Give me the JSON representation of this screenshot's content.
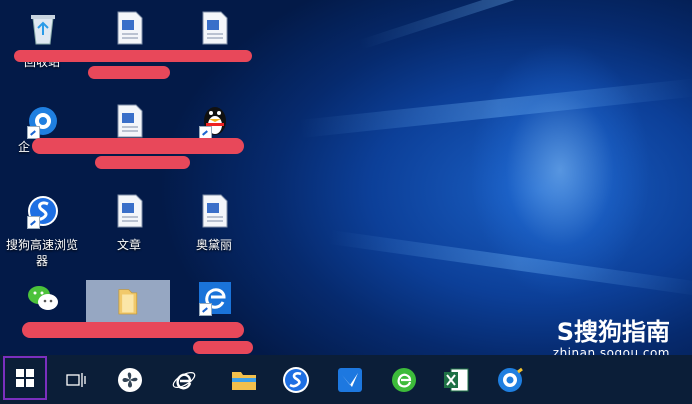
{
  "desktop": {
    "icons": [
      {
        "id": "recycle",
        "label": "回收站"
      },
      {
        "id": "doc1",
        "label": ""
      },
      {
        "id": "doc2",
        "label": ""
      },
      {
        "id": "qiyi",
        "label": "企"
      },
      {
        "id": "doc3",
        "label": ""
      },
      {
        "id": "qq",
        "label": ""
      },
      {
        "id": "sogou-browser",
        "label": "搜狗高速浏览\n器"
      },
      {
        "id": "wenzhang",
        "label": "文章"
      },
      {
        "id": "aodaili",
        "label": "奥黛丽"
      },
      {
        "id": "wechat",
        "label": ""
      },
      {
        "id": "folder",
        "label": ""
      },
      {
        "id": "edge",
        "label": ""
      }
    ]
  },
  "taskbar": {
    "items": [
      "start",
      "task-view",
      "fan-app",
      "ie",
      "file-explorer",
      "sogou",
      "feishu",
      "ie-green",
      "excel",
      "360"
    ]
  },
  "watermark": {
    "brand": "S搜狗指南",
    "url": "zhinan.sogou.com"
  },
  "colors": {
    "redact": "#e8485a",
    "taskbar": "#0b1e38",
    "start_highlight": "#7b2fbf"
  }
}
